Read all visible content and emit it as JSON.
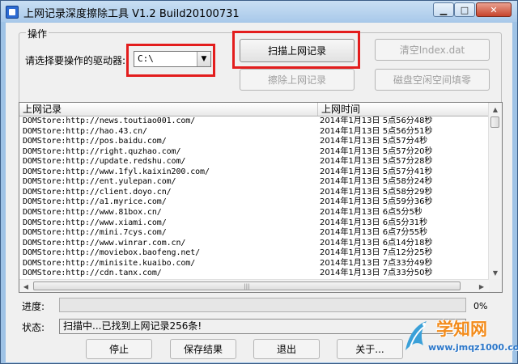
{
  "window": {
    "title": "上网记录深度擦除工具 V1.2   Build20100731",
    "minimize_glyph": "▁",
    "maximize_glyph": "□",
    "close_glyph": "✕"
  },
  "group": {
    "title": "操作",
    "drive_label": "请选择要操作的驱动器:",
    "drive_value": "C:\\",
    "drive_arrow": "▼"
  },
  "buttons": {
    "scan": "扫描上网记录",
    "erase": "擦除上网记录",
    "clear_index": "清空Index.dat",
    "fill_free_space": "磁盘空闲空间填零",
    "stop": "停止",
    "save": "保存结果",
    "exit": "退出",
    "about": "关于..."
  },
  "list": {
    "columns": [
      "上网记录",
      "上网时间"
    ],
    "rows": [
      {
        "url": "DOMStore:http://news.toutiao001.com/",
        "time": "2014年1月13日  5点56分48秒"
      },
      {
        "url": "DOMStore:http://hao.43.cn/",
        "time": "2014年1月13日  5点56分51秒"
      },
      {
        "url": "DOMStore:http://pos.baidu.com/",
        "time": "2014年1月13日  5点57分4秒"
      },
      {
        "url": "DOMStore:http://right.quzhao.com/",
        "time": "2014年1月13日  5点57分20秒"
      },
      {
        "url": "DOMStore:http://update.redshu.com/",
        "time": "2014年1月13日  5点57分28秒"
      },
      {
        "url": "DOMStore:http://www.1fyl.kaixin200.com/",
        "time": "2014年1月13日  5点57分41秒"
      },
      {
        "url": "DOMStore:http://ent.yulepan.com/",
        "time": "2014年1月13日  5点58分24秒"
      },
      {
        "url": "DOMStore:http://client.doyo.cn/",
        "time": "2014年1月13日  5点58分29秒"
      },
      {
        "url": "DOMStore:http://a1.myrice.com/",
        "time": "2014年1月13日  5点59分36秒"
      },
      {
        "url": "DOMStore:http://www.81box.cn/",
        "time": "2014年1月13日  6点5分5秒"
      },
      {
        "url": "DOMStore:http://www.xiami.com/",
        "time": "2014年1月13日  6点5分31秒"
      },
      {
        "url": "DOMStore:http://mini.7cys.com/",
        "time": "2014年1月13日  6点7分55秒"
      },
      {
        "url": "DOMStore:http://www.winrar.com.cn/",
        "time": "2014年1月13日  6点14分18秒"
      },
      {
        "url": "DOMStore:http://moviebox.baofeng.net/",
        "time": "2014年1月13日  7点12分25秒"
      },
      {
        "url": "DOMStore:http://minisite.kuaibo.com/",
        "time": "2014年1月13日  7点33分49秒"
      },
      {
        "url": "DOMStore:http://cdn.tanx.com/",
        "time": "2014年1月13日  7点33分50秒"
      }
    ],
    "scroll_up_glyph": "▲",
    "scroll_down_glyph": "▼",
    "scroll_left_glyph": "◀",
    "scroll_right_glyph": "▶",
    "hthumb_grip": "|||"
  },
  "progress": {
    "label": "进度:",
    "percent_text": "0%",
    "value": 0
  },
  "status": {
    "label": "状态:",
    "text": "扫描中...已找到上网记录256条!"
  },
  "watermark": {
    "name": "学知网",
    "url": "www.jmqz1000.com"
  },
  "colors": {
    "highlight": "#e31d1d",
    "watermark_orange": "#f28b1b",
    "watermark_blue": "#2a76c9"
  }
}
